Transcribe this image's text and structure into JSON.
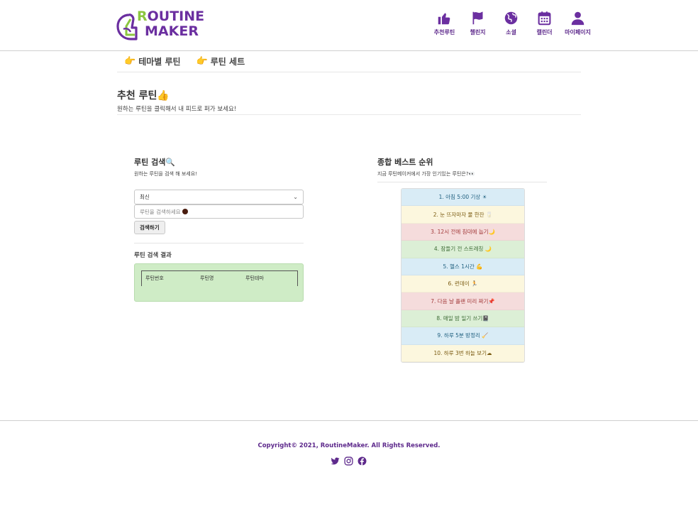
{
  "brand": {
    "logo_line1_initial": "R",
    "logo_line1_rest": "OUTINE",
    "logo_line2": "MAKER",
    "logo_color": "#6b2fa0",
    "accent_green": "#8cc63f"
  },
  "nav": [
    {
      "label": "추천루틴",
      "icon": "thumbs-up-icon"
    },
    {
      "label": "챌린지",
      "icon": "flag-icon"
    },
    {
      "label": "소셜",
      "icon": "globe-icon"
    },
    {
      "label": "캘린더",
      "icon": "calendar-icon"
    },
    {
      "label": "마이페이지",
      "icon": "user-icon"
    }
  ],
  "subnav": [
    {
      "label": "테마별 루틴",
      "icon": "pointing-hand-icon"
    },
    {
      "label": "루틴 세트",
      "icon": "pointing-hand-icon"
    }
  ],
  "page": {
    "title": "추천 루틴👍",
    "subtitle": "원하는 루틴을 클릭해서 내 피드로 퍼가 보세요!"
  },
  "search": {
    "title": "루틴 검색🔍",
    "subtitle": "원하는 루틴을 검색 해 보세요!",
    "select_value": "최신",
    "placeholder": "루틴을 검색하세요",
    "button": "검색하기",
    "result_title": "루틴 검색 결과",
    "columns": [
      "루틴번호",
      "루틴명",
      "루틴테마"
    ]
  },
  "ranking": {
    "title": "종합 베스트 순위",
    "subtitle": "지금 루틴메이커에서 가장 인기있는 루틴은?👀",
    "items": [
      {
        "text": "1. 아침 5:00 기상 ☀",
        "style": "blue"
      },
      {
        "text": "2. 눈 뜨자마자 물 한잔 🥛",
        "style": "yellow"
      },
      {
        "text": "3. 12시 전에 침대에 눕기🌙",
        "style": "red"
      },
      {
        "text": "4. 잠들기 전 스트레칭 🌙",
        "style": "green"
      },
      {
        "text": "5. 헬스 1시간 💪",
        "style": "blue"
      },
      {
        "text": "6. 런데이 🏃",
        "style": "yellow"
      },
      {
        "text": "7. 다음 날 플랜 미리 짜기📌",
        "style": "red"
      },
      {
        "text": "8. 매일 밤 일기 쓰기📓",
        "style": "green"
      },
      {
        "text": "9. 하루 5분 방정리 🧹",
        "style": "blue"
      },
      {
        "text": "10. 하루 3번 하늘 보기☁",
        "style": "yellow"
      }
    ]
  },
  "footer": {
    "copyright": "Copyright© 2021, RoutineMaker. All Rights Reserved.",
    "social": [
      "twitter-icon",
      "instagram-icon",
      "facebook-icon"
    ]
  }
}
